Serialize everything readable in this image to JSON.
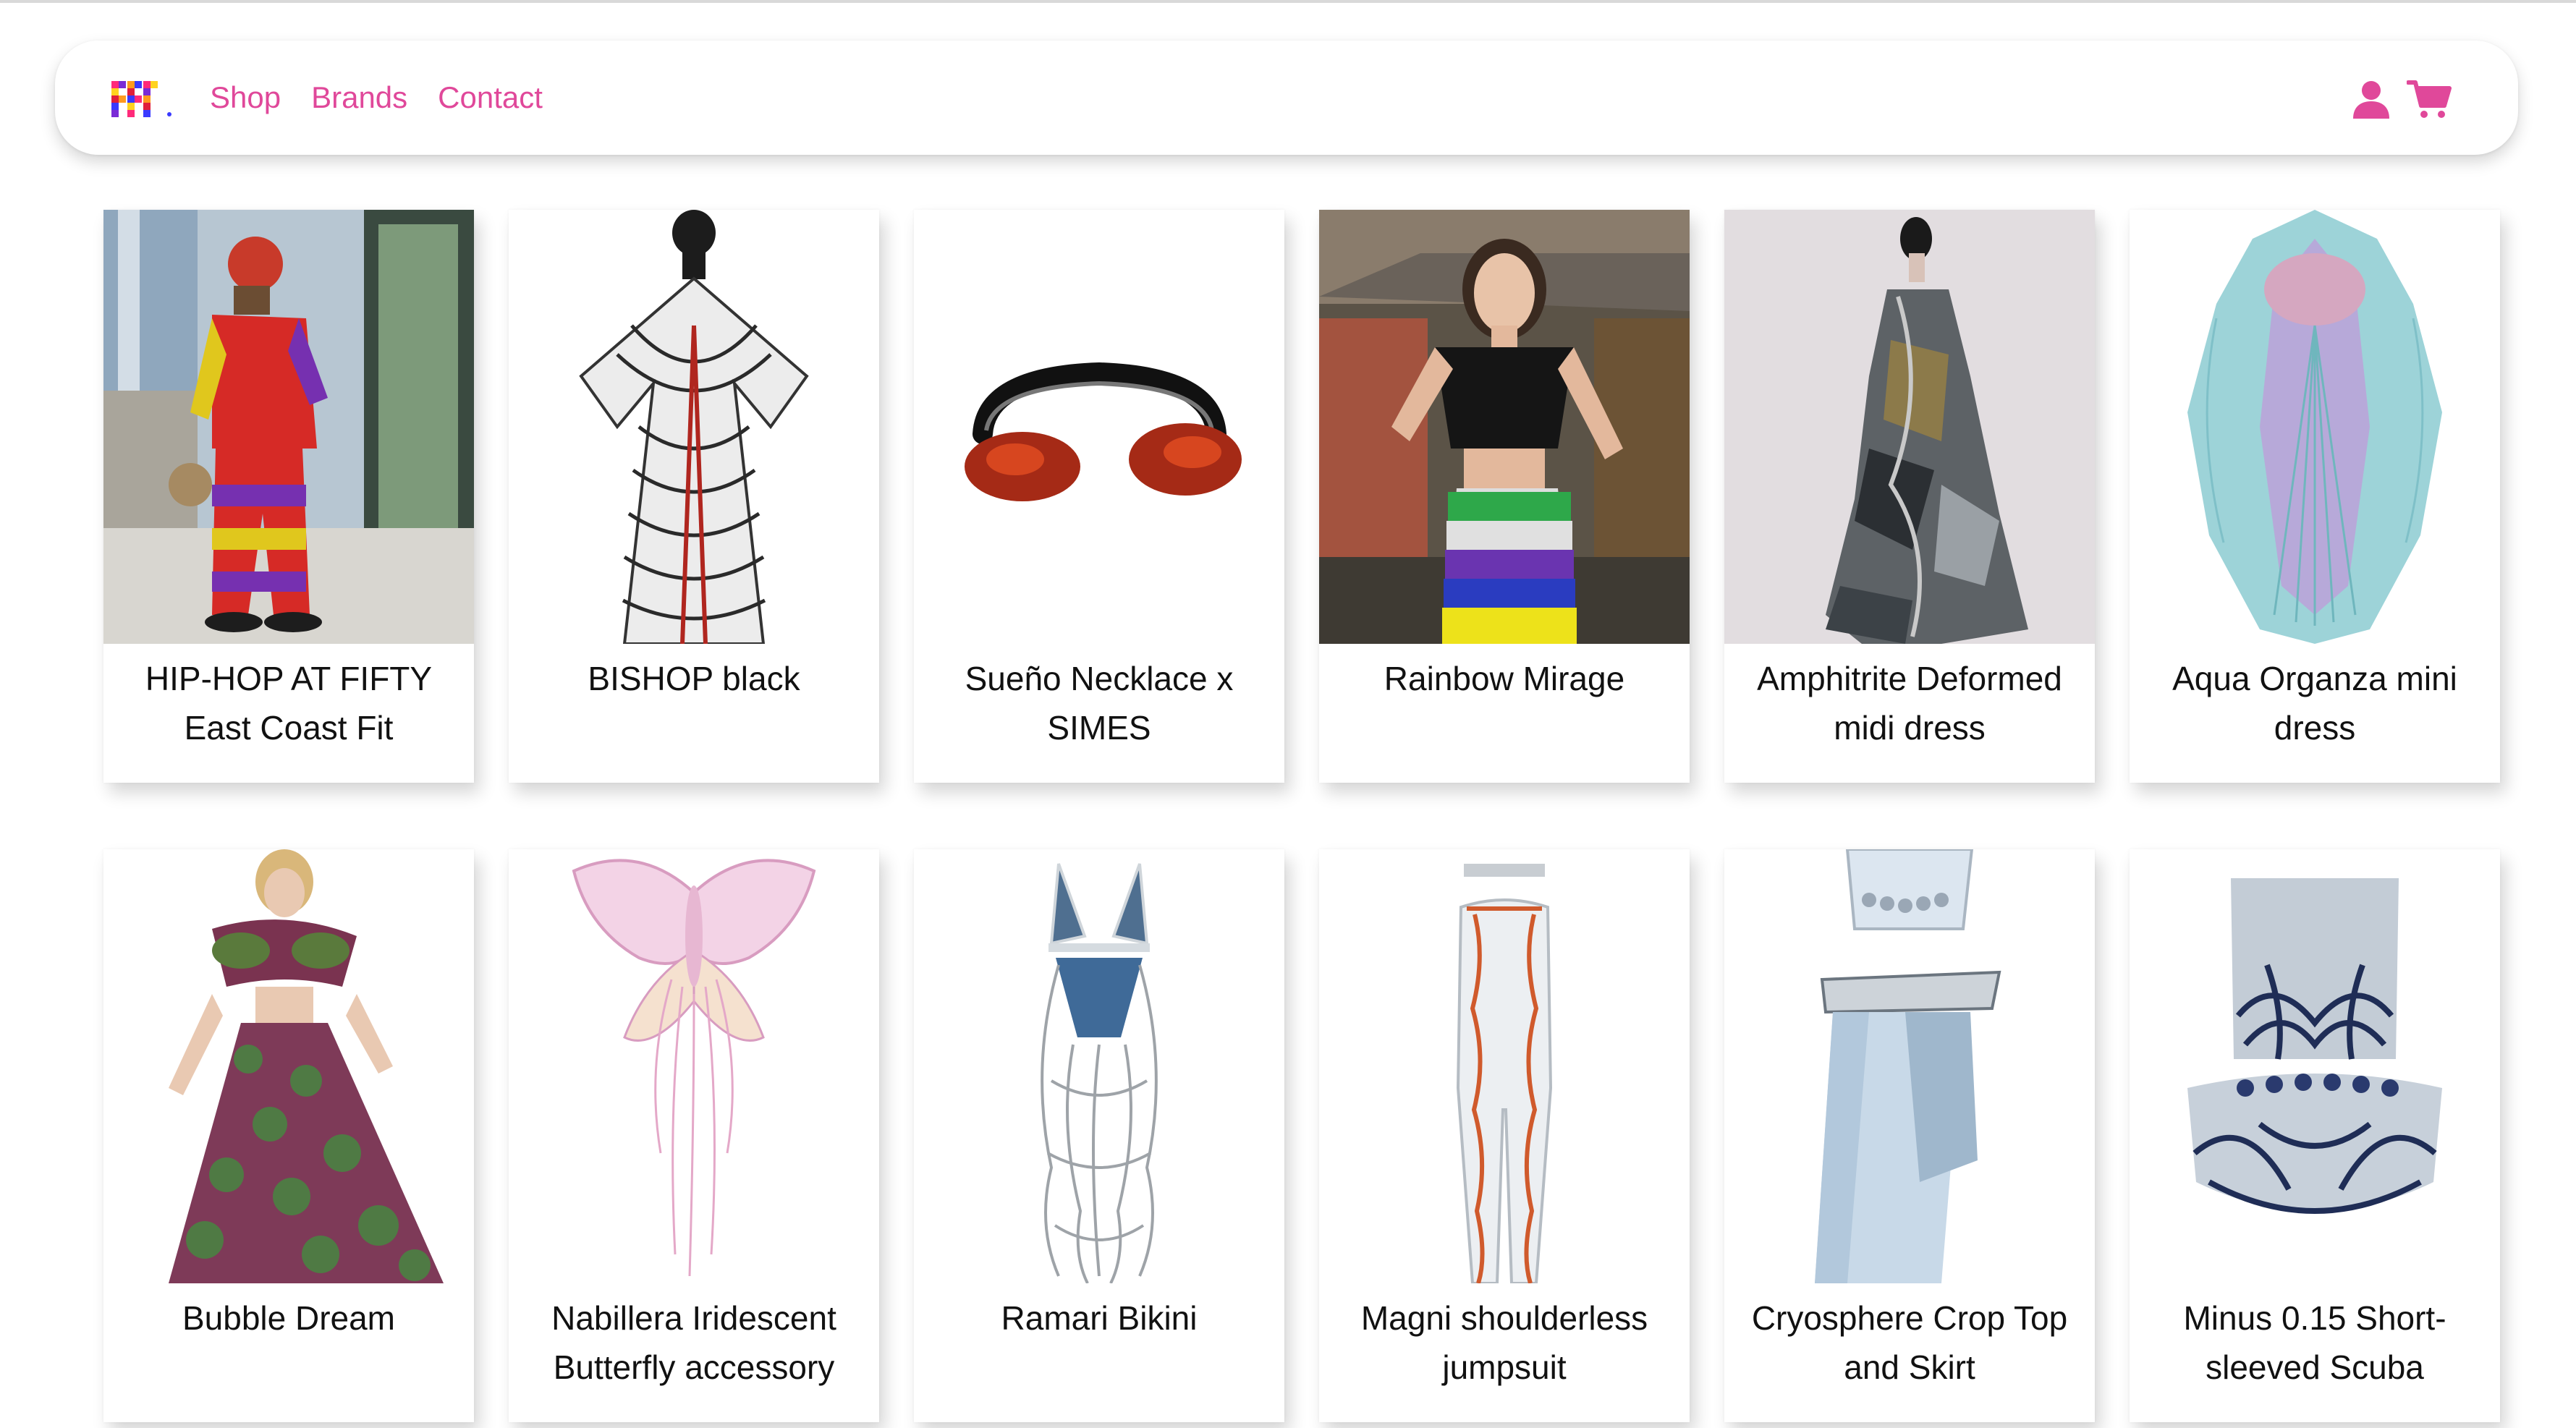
{
  "nav": {
    "links": [
      "Shop",
      "Brands",
      "Contact"
    ]
  },
  "colors": {
    "accent": "#e0489a"
  },
  "icons": {
    "user": "user-icon",
    "cart": "cart-icon",
    "logo": "brand-logo"
  },
  "products": [
    {
      "name": "HIP-HOP AT FIFTY East Coast Fit"
    },
    {
      "name": "BISHOP black"
    },
    {
      "name": "Sueño Necklace x SIMES"
    },
    {
      "name": "Rainbow Mirage"
    },
    {
      "name": "Amphitrite Deformed midi dress"
    },
    {
      "name": "Aqua Organza mini dress"
    },
    {
      "name": "Bubble Dream"
    },
    {
      "name": "Nabillera Iridescent Butterfly accessory"
    },
    {
      "name": "Ramari Bikini"
    },
    {
      "name": "Magni shoulderless jumpsuit"
    },
    {
      "name": "Cryosphere Crop Top and Skirt"
    },
    {
      "name": "Minus 0.15 Short-sleeved Scuba"
    }
  ]
}
